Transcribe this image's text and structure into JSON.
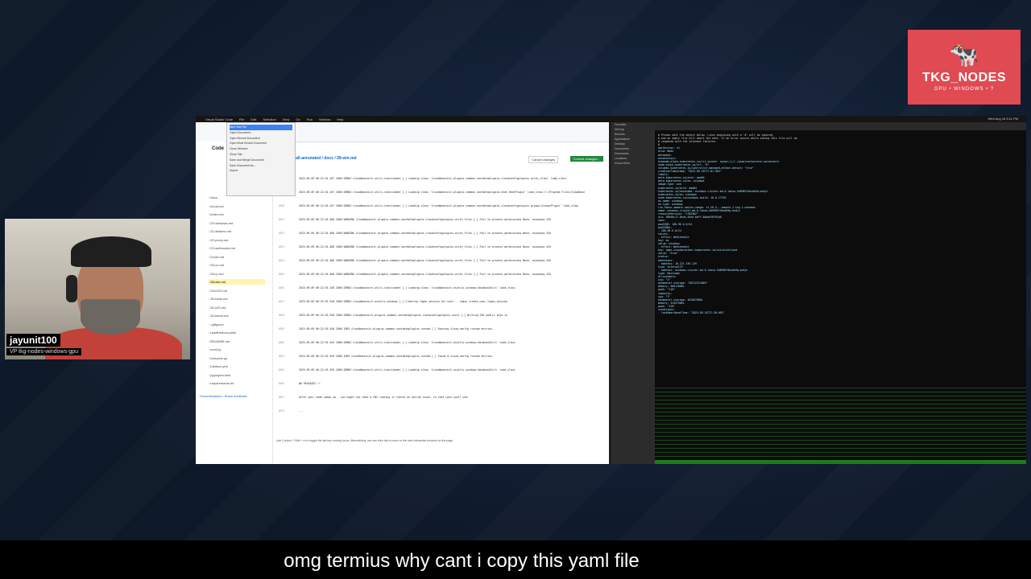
{
  "brand": {
    "name": "TKG_NODES",
    "tagline": "GPU • WINDOWS • ?"
  },
  "presenter": {
    "name": "jayunit100",
    "role": "VP tkg-nodes-windows-gpu"
  },
  "caption": "omg termius why cant i copy this yaml file",
  "menubar": {
    "items": [
      "Visual Studio Code",
      "File",
      "Edit",
      "Selection",
      "View",
      "Go",
      "Run",
      "Window",
      "Help"
    ],
    "clock": "Wed Aug 16 5:11 PM"
  },
  "file_menu": [
    "New Text File",
    "Open Document...",
    "Open Recent Document",
    "Open Most Recent Document",
    "Close Window",
    "Close Tab",
    "Save and Merge Document",
    "Save Document As...",
    "Import"
  ],
  "editor": {
    "repo_path": "all-annotated / docs / 28-win.md",
    "cancel_label": "Cancel changes",
    "commit_label": "Commit changes...",
    "sidebar_title": "Code",
    "sidebar_files": [
      "docs",
      "cloud.md",
      "index.md",
      "20-windows.md",
      "21-addons.md",
      "22-proxy.md",
      "23-webhooks.md",
      "24-tkr.md",
      "25-cc.md",
      "26-rp.md",
      "28-win.md",
      "29-K2G.md",
      "30-fonts.md",
      "31-k23.md",
      "32-tarzul.md",
      ".gitignore",
      "readthedocs.yaml",
      "README.md",
      "conf.py",
      "tomoche.py",
      "mkdocs.yml",
      "pyproject.toml",
      "requirements.txt"
    ],
    "sidebar_footer": "Documentation • Share feedback",
    "code_lines": [
      {
        "n": "1848",
        "t": "2023-09-09 06:22:54.167 2000 DEBUG cloudbaseinit.utils.classloader [-] Loading class 'cloudbaseinit.plugins.common.userdataplugins.cloudconfigplugins.write_files' load_class"
      },
      {
        "n": "1849",
        "t": "2023-09-09 06:22:54.167 2000 DEBUG cloudbaseinit.utils.classloader [-] Loading class 'cloudbaseinit.plugins.common.userdataplugins.heat.HeatPlugin' load_class C:\\Program Files\\Cloudbase"
      },
      {
        "n": "1850",
        "t": "2023-09-09 06:22:54.167 2000 DEBUG cloudbaseinit.utils.classloader [-] Loading class 'cloudbaseinit.plugins.common.userdataplugins.cloudconfigplugins.groups.GroupsPlugin' load_class"
      },
      {
        "n": "1851",
        "t": "2023-09-09 06:22:54.408 2000 WARNING cloudbaseinit.plugins.common.userdataplugins.cloudconfigplugins.write_files [-] Fail to process permissions None, assuming 420"
      },
      {
        "n": "1852",
        "t": "2023-09-09 06:22:54.408 2000 WARNING cloudbaseinit.plugins.common.userdataplugins.cloudconfigplugins.write_files [-] Fail to process permissions None, assuming 420"
      },
      {
        "n": "1853",
        "t": "2023-09-09 06:22:54.408 2000 WARNING cloudbaseinit.plugins.common.userdataplugins.cloudconfigplugins.write_files [-] Fail to process permissions None, assuming 420"
      },
      {
        "n": "1854",
        "t": "2023-09-09 06:22:54.408 2000 WARNING cloudbaseinit.plugins.common.userdataplugins.cloudconfigplugins.write_files [-] Fail to process permissions None, assuming 420"
      },
      {
        "n": "1855",
        "t": "2023-09-09 06:22:54.408 2000 WARNING cloudbaseinit.plugins.common.userdataplugins.cloudconfigplugins.write_files [-] Fail to process permissions None, assuming 420"
      },
      {
        "n": "1856",
        "t": "2023-09-09 06:22:55.438 2000 DEBUG cloudbaseinit.utils.classloader [-] Loading class 'cloudbaseinit.osutils.windows.WindowsUtils' load_class"
      },
      {
        "n": "1857",
        "t": "2023-09-09 06:22:55.548 2000 DEBUG cloudbaseinit.osutils.windows [-] Creating logon session for user: . Logon create_user_logon_session"
      },
      {
        "n": "1858",
        "t": "2023-09-09 06:22:55.548 2000 DEBUG cloudbaseinit.plugins.common.userdataplugins.cloudconfigplugins.users [-] Writing SSH public keys in"
      },
      {
        "n": "1859",
        "t": "2023-09-09 06:22:55.548 2000 INFO cloudbaseinit.plugins.common.userdataplugins.runcmd [-] Running cloud-config runcmd entries."
      },
      {
        "n": "1860",
        "t": "2023-09-09 06:22:55.549 2000 DEBUG cloudbaseinit.utils.classloader [-] Loading class 'cloudbaseinit.osutils.windows.WindowsUtils' load_class"
      },
      {
        "n": "1861",
        "t": "2023-09-09 06:22:55.549 2000 INFO cloudbaseinit.plugins.common.userdataplugins.runcmd [-] Found 0 cloud-config runcmd entries."
      },
      {
        "n": "1862",
        "t": "2023-09-09 06:22:55.550 2000 DEBUG cloudbaseinit.utils.classloader [-] Loading class 'cloudbaseinit.osutils.windows.WindowsUtils' load_class"
      },
      {
        "n": "1865",
        "t": "## PACKAGES !!"
      },
      {
        "n": "1867",
        "t": "After your node comes up , you might not have a CNI running if theres an antrea issue.  In that case youll see:"
      },
      {
        "n": "1870",
        "t": "..."
      }
    ],
    "tooltip": "Use Control + Shift + m to toggle the tab key moving focus. Alternatively, use esc then tab to move to the next interactive element on the page."
  },
  "finder": [
    "Favorites",
    "AirDrop",
    "Recents",
    "Applications",
    "Desktop",
    "Documents",
    "Downloads",
    "Locations",
    "iCloud Drive"
  ],
  "terminal": {
    "yaml_lines": [
      "# Please edit the object below. Lines beginning with a '#' will be ignored,",
      "# and an empty file will abort the edit. If an error occurs while saving this file will be",
      "# reopened with the relevant failures.",
      "#",
      "apiVersion: v1",
      "kind: Node",
      "metadata:",
      "  annotations:",
      "    kubeadm.alpha.kubernetes.io/cri-socket: npipe:////./pipe/containerd-containerd",
      "    node.alpha.kubernetes.io/ttl: \"0\"",
      "    volumes.kubernetes.io/controller-managed-attach-detach: \"true\"",
      "  creationTimestamp: \"2023-09-16T17:01:40Z\"",
      "  labels:",
      "    beta.kubernetes.io/arch: amd64",
      "    beta.kubernetes.io/os: windows",
      "    image-type: ova",
      "    kubernetes.io/arch: amd64",
      "    kubernetes.io/hostname: windows-cluster-md-0-lmnvw-5d6965f4bxdk9q-mvdjn",
      "    kubernetes.io/os: windows",
      "    node.kubernetes.io/windows-build: 10.0.17763",
      "    os-name: windows",
      "    os-type: windows",
      "    run.tanzu.vmware.com/os-image: v1.26.5---vmware.1-tkg.1-windows",
      "  name: windows-cluster-md-0-lmnvw-5d6965f4bxdk9q-mvdjn",
      "  resourceVersion: \"1765462\"",
      "  uid: 385d0c17-8e4a-45ed-bdff-8b4a0f8f91b8",
      "spec:",
      "  podCIDR: 100.96.6.0/24",
      "  podCIDRs:",
      "  - 100.96.6.0/24",
      "  taints:",
      "  - effect: NoSchedule",
      "    key: os",
      "    value: windows",
      "  - effect: NoSchedule",
      "    key: node.cloudprovider.kubernetes.io/uninitialized",
      "    value: \"true\"",
      "status:",
      "  addresses:",
      "  - address: 10.221.159.129",
      "    type: InternalIP",
      "  - address: windows-cluster-md-0-lmnvw-5d6965f4bxdk9q-mvdjn",
      "    type: Hostname",
      "  allocatable:",
      "    cpu: \"2\"",
      "    ephemeral-storage: \"36512311869\"",
      "    memory: 4001100Ki",
      "    pods: \"110\"",
      "  capacity:",
      "    cpu: \"2\"",
      "    ephemeral-storage: 40160788Ki",
      "    memory: 4103756Ki",
      "    pods: \"110\"",
      "  conditions:",
      "  - lastHeartbeatTime: \"2023-09-16T17:28:09Z\""
    ]
  }
}
